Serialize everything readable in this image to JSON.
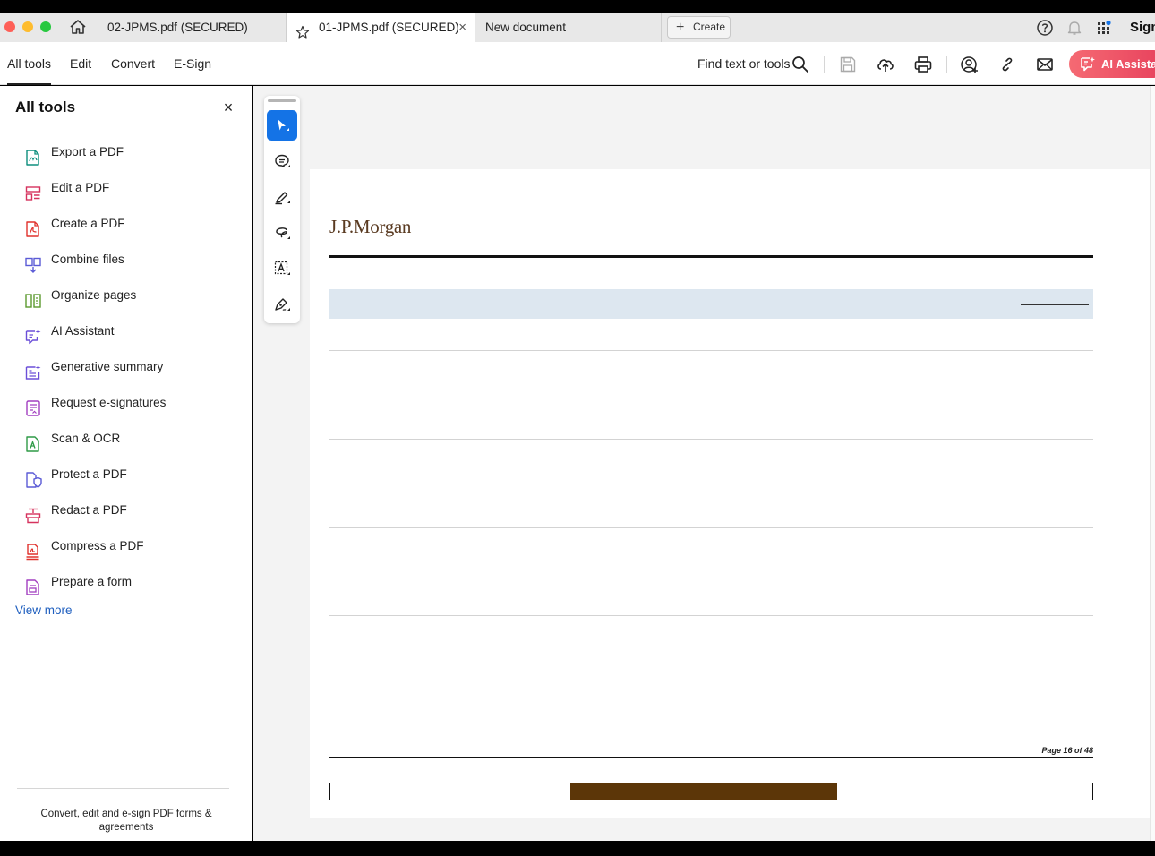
{
  "tabs": [
    {
      "label": "02-JPMS.pdf (SECURED)"
    },
    {
      "label": "01-JPMS.pdf (SECURED)"
    },
    {
      "label": "New document"
    }
  ],
  "tab_close": "×",
  "create_label": "Create",
  "sign_label": "Sign",
  "menu": {
    "all_tools": "All tools",
    "edit": "Edit",
    "convert": "Convert",
    "esign": "E-Sign"
  },
  "find_label": "Find text or tools",
  "ai_button_label": "AI Assistant",
  "panel": {
    "title": "All tools",
    "close": "×",
    "tools": [
      {
        "label": "Export a PDF",
        "icon": "export-pdf-icon",
        "color": "#0e8f7e"
      },
      {
        "label": "Edit a PDF",
        "icon": "edit-pdf-icon",
        "color": "#d6325e"
      },
      {
        "label": "Create a PDF",
        "icon": "create-pdf-icon",
        "color": "#e0322d"
      },
      {
        "label": "Combine files",
        "icon": "combine-files-icon",
        "color": "#5b5bd6"
      },
      {
        "label": "Organize pages",
        "icon": "organize-pages-icon",
        "color": "#5c9a2f"
      },
      {
        "label": "AI Assistant",
        "icon": "ai-assistant-icon",
        "color": "#6b4fd8"
      },
      {
        "label": "Generative summary",
        "icon": "generative-summary-icon",
        "color": "#6b4fd8"
      },
      {
        "label": "Request e-signatures",
        "icon": "request-esignatures-icon",
        "color": "#a23ec0"
      },
      {
        "label": "Scan & OCR",
        "icon": "scan-ocr-icon",
        "color": "#2f9a47"
      },
      {
        "label": "Protect a PDF",
        "icon": "protect-pdf-icon",
        "color": "#5b5bd6"
      },
      {
        "label": "Redact a PDF",
        "icon": "redact-pdf-icon",
        "color": "#d6325e"
      },
      {
        "label": "Compress a PDF",
        "icon": "compress-pdf-icon",
        "color": "#e0322d"
      },
      {
        "label": "Prepare a form",
        "icon": "prepare-form-icon",
        "color": "#a23ec0"
      }
    ],
    "view_more": "View more",
    "footer": "Convert, edit and e-sign PDF forms & agreements"
  },
  "document": {
    "logo_text": "J.P.Morgan",
    "page_label": "Page  16 of 48"
  },
  "colors": {
    "accent_blue": "#1473e6",
    "ai_gradient_start": "#f56a73",
    "ai_gradient_end": "#e7405c",
    "logo_brown": "#5a3b22",
    "footer_bar_brown": "#5c3608"
  }
}
